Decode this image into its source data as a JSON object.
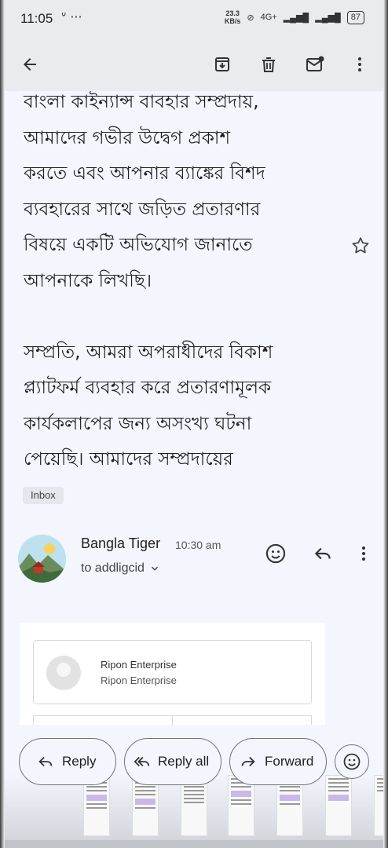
{
  "status_bar": {
    "time": "11:05",
    "net_speed_value": "23.3",
    "net_speed_unit": "KB/s",
    "network": "4G+",
    "battery": "87"
  },
  "toolbar": {
    "back_icon": "arrow-left-icon",
    "archive_icon": "archive-icon",
    "delete_icon": "trash-icon",
    "mark_unread_icon": "mail-unread-icon",
    "more_icon": "more-vert-icon"
  },
  "email": {
    "body": "বাংলা কাইন্যান্স বাবহার সম্প্রদায়,\nআমাদের গভীর উদ্বেগ প্রকাশ\nকরতে এবং আপনার ব্যাঙ্কের বিশদ\nব্যবহারের সাথে জড়িত প্রতারণার\nবিষয়ে একটি অভিযোগ জানাতে\nআপনাকে লিখছি।\n\nসম্প্রতি, আমরা অপরাধীদের বিকাশ\nপ্ল্যাটফর্ম ব্যবহার করে প্রতারণামূলক\nকার্যকলাপের জন্য অসংখ্য ঘটনা\nপেয়েছি। আমাদের সম্প্রদায়ের\nব্যবহারকারীরা নিয়মিত এমন ঘট�",
    "label": "Inbox"
  },
  "message": {
    "sender": "Bangla Tiger",
    "time": "10:30 am",
    "to": "to addligcid"
  },
  "embed": {
    "name": "Ripon Enterprise",
    "subtitle": "Ripon Enterprise"
  },
  "actions": {
    "reply": "Reply",
    "reply_all": "Reply all",
    "forward": "Forward"
  },
  "colors": {
    "background": "#f3f6fc",
    "toolbar": "#e9ebee",
    "text": "#1f1f1f"
  }
}
